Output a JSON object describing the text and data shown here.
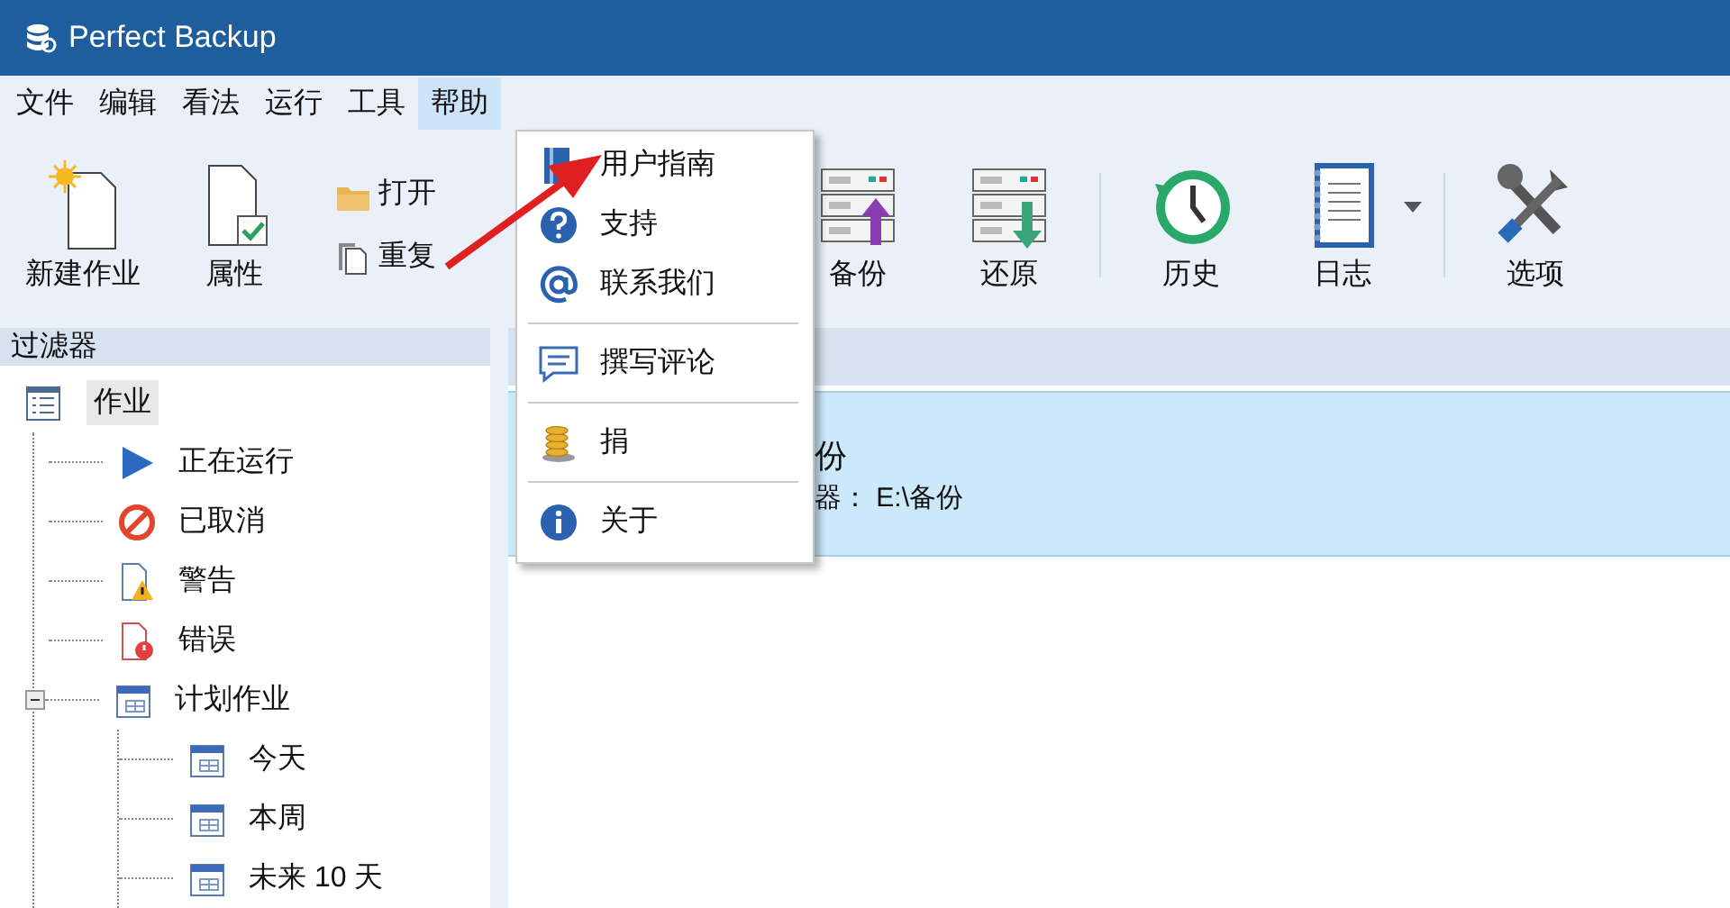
{
  "window": {
    "title": "Perfect Backup"
  },
  "menu_bar": [
    {
      "label": "文件",
      "selected": false
    },
    {
      "label": "编辑",
      "selected": false
    },
    {
      "label": "看法",
      "selected": false
    },
    {
      "label": "运行",
      "selected": false
    },
    {
      "label": "工具",
      "selected": false
    },
    {
      "label": "帮助",
      "selected": true
    }
  ],
  "toolbar": {
    "groups": [
      [
        {
          "kind": "large",
          "label": "新建作业"
        },
        {
          "kind": "large",
          "label": "属性"
        },
        {
          "kind": "small",
          "label": "打开"
        },
        {
          "kind": "small",
          "label": "重复"
        },
        {
          "kind": "large",
          "label": "备份"
        },
        {
          "kind": "large",
          "label": "还原"
        }
      ],
      [
        {
          "kind": "large",
          "label": "历史"
        },
        {
          "kind": "dropdown",
          "label": "日志"
        }
      ],
      [
        {
          "kind": "large",
          "label": "选项"
        }
      ]
    ]
  },
  "filter_panel": {
    "title": "过滤器",
    "tree": [
      {
        "label": "作业",
        "selected": true,
        "expanded": true,
        "children": [
          {
            "label": "正在运行",
            "selected": false
          },
          {
            "label": "已取消",
            "selected": false
          },
          {
            "label": "警告",
            "selected": false
          },
          {
            "label": "错误",
            "selected": false
          },
          {
            "label": "计划作业",
            "selected": false,
            "expanded": true,
            "children": [
              {
                "label": "今天",
                "selected": false
              },
              {
                "label": "本周",
                "selected": false
              },
              {
                "label": "未来 10 天",
                "selected": false
              }
            ]
          }
        ]
      }
    ]
  },
  "job_list": {
    "rows": [
      {
        "title": "份",
        "detail": "器： E:\\备份",
        "selected": true
      }
    ]
  },
  "help_menu": {
    "items": [
      {
        "kind": "item",
        "label": "用户指南"
      },
      {
        "kind": "item",
        "label": "支持"
      },
      {
        "kind": "item",
        "label": "联系我们"
      },
      {
        "kind": "separator"
      },
      {
        "kind": "item",
        "label": "撰写评论"
      },
      {
        "kind": "separator"
      },
      {
        "kind": "item",
        "label": "捐"
      },
      {
        "kind": "separator"
      },
      {
        "kind": "item",
        "label": "关于"
      }
    ]
  },
  "annotation": {
    "kind": "arrow"
  }
}
